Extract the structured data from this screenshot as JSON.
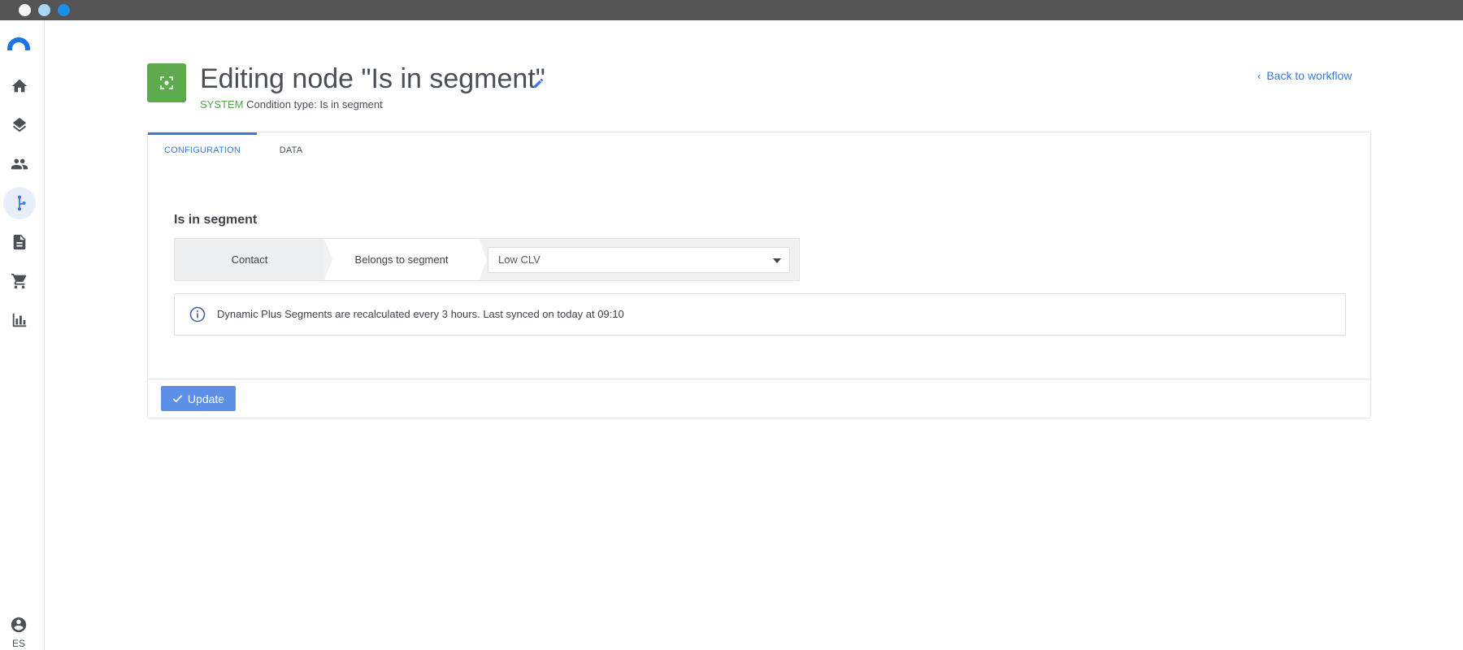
{
  "window": {
    "controls": [
      "close",
      "minimize",
      "maximize"
    ]
  },
  "sidebar": {
    "logo": "logo-arc",
    "items": [
      {
        "name": "home",
        "icon": "home-icon",
        "active": false
      },
      {
        "name": "layers",
        "icon": "layers-icon",
        "active": false
      },
      {
        "name": "contacts",
        "icon": "people-icon",
        "active": false
      },
      {
        "name": "workflows",
        "icon": "workflow-icon",
        "active": true
      },
      {
        "name": "documents",
        "icon": "document-icon",
        "active": false
      },
      {
        "name": "commerce",
        "icon": "cart-icon",
        "active": false
      },
      {
        "name": "reports",
        "icon": "bar-chart-icon",
        "active": false
      }
    ],
    "user": {
      "icon": "account-icon",
      "language": "ES"
    }
  },
  "header": {
    "title": "Editing node \"Is in segment\"",
    "system_label": "SYSTEM",
    "condition_type": "Condition type: Is in segment",
    "back_link": "Back to workflow",
    "node_color": "#5eaa4e",
    "accent_color": "#3a7ae0"
  },
  "tabs": [
    {
      "label": "CONFIGURATION",
      "active": true
    },
    {
      "label": "DATA",
      "active": false
    }
  ],
  "configuration": {
    "section_title": "Is in segment",
    "condition": {
      "subject": "Contact",
      "operator": "Belongs to segment",
      "value": "Low CLV"
    },
    "info": "Dynamic Plus Segments are recalculated every 3 hours. Last synced on today at 09:10"
  },
  "footer": {
    "update_label": "Update"
  }
}
